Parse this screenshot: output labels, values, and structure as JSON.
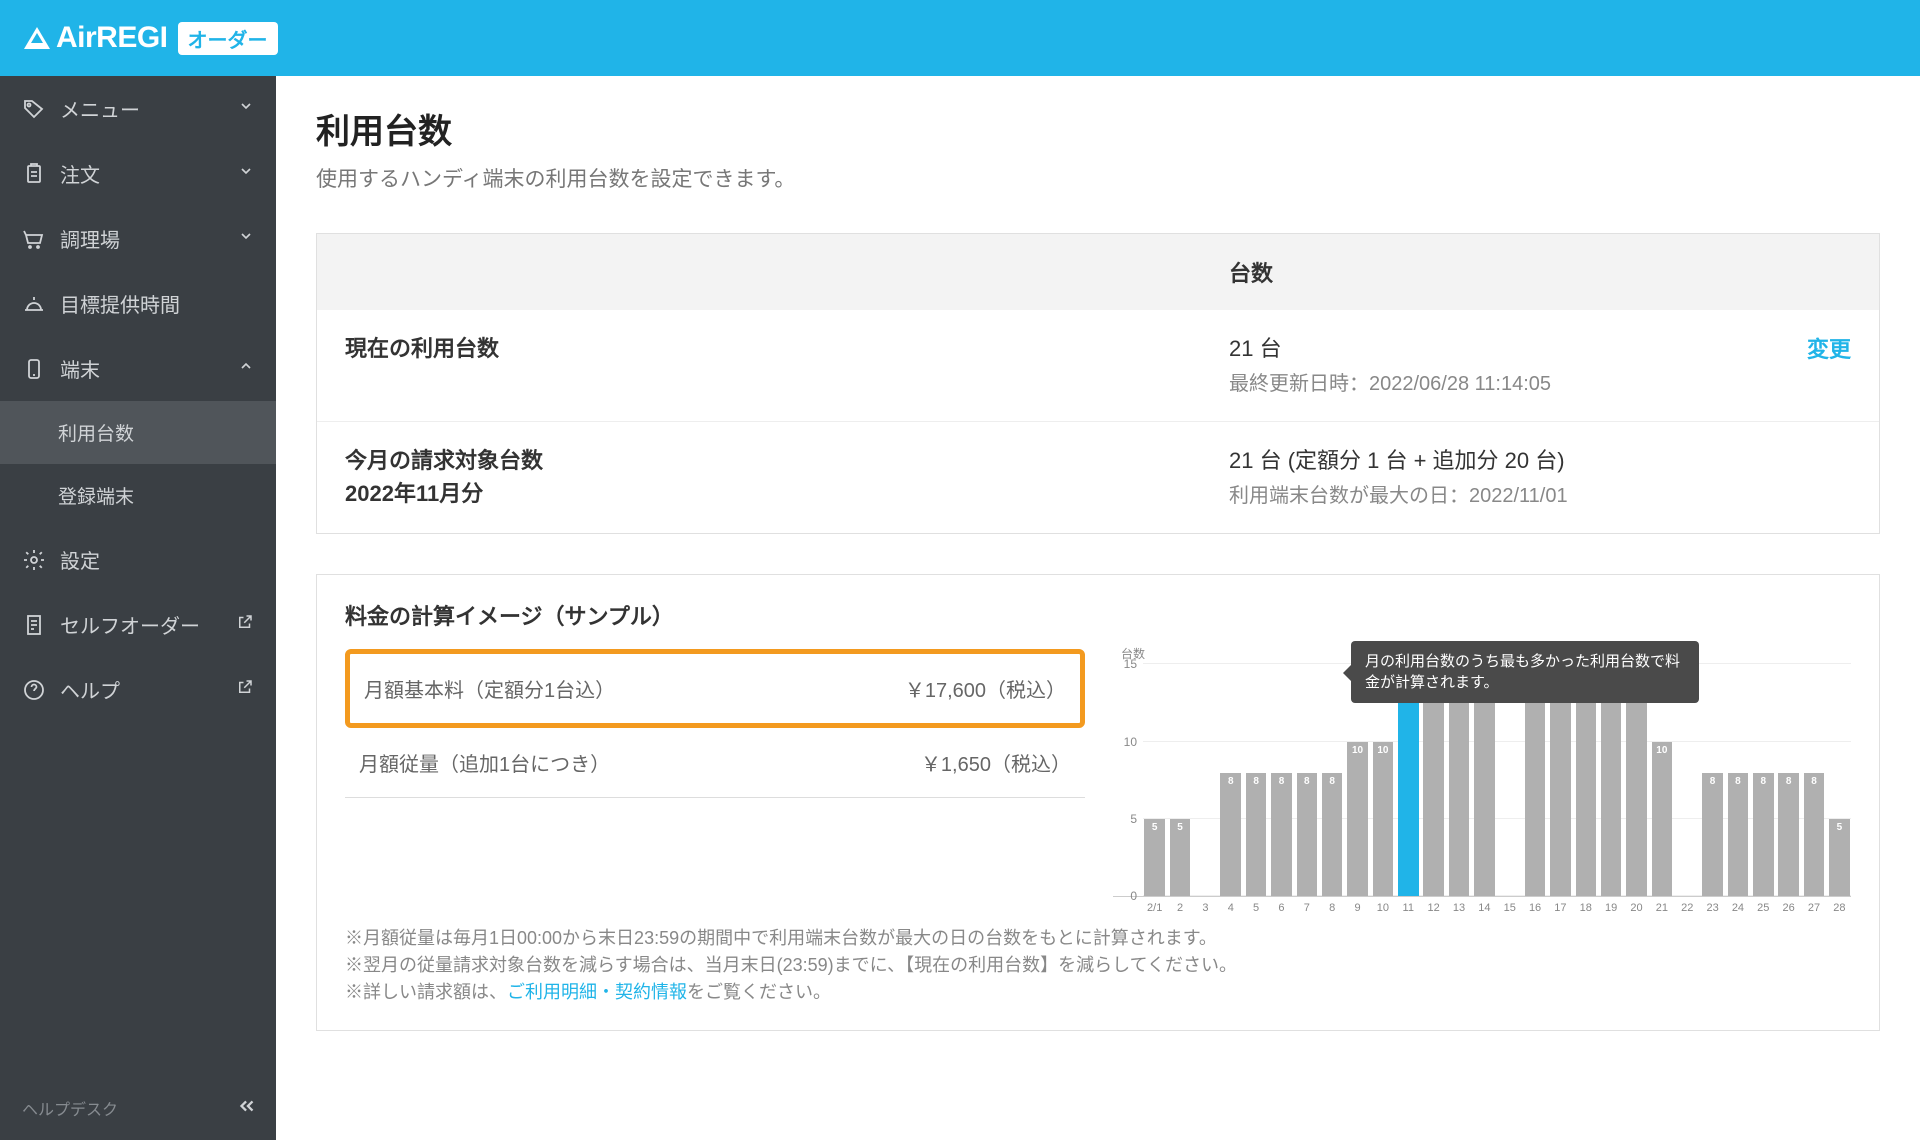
{
  "header": {
    "brand": "AirREGI",
    "badge": "オーダー"
  },
  "sidebar": {
    "items": [
      {
        "id": "menu",
        "label": "メニュー",
        "icon": "tag",
        "expandable": true
      },
      {
        "id": "order",
        "label": "注文",
        "icon": "clipboard",
        "expandable": true
      },
      {
        "id": "kitchen",
        "label": "調理場",
        "icon": "cart",
        "expandable": true
      },
      {
        "id": "target",
        "label": "目標提供時間",
        "icon": "dish"
      },
      {
        "id": "terminal",
        "label": "端末",
        "icon": "phone",
        "expandable": true,
        "expanded": true,
        "children": [
          {
            "id": "usage",
            "label": "利用台数",
            "active": true
          },
          {
            "id": "registered",
            "label": "登録端末"
          }
        ]
      },
      {
        "id": "settings",
        "label": "設定",
        "icon": "gear"
      },
      {
        "id": "selforder",
        "label": "セルフオーダー",
        "icon": "receipt",
        "external": true
      },
      {
        "id": "help",
        "label": "ヘルプ",
        "icon": "help",
        "external": true
      }
    ],
    "helpdesk": "ヘルプデスク"
  },
  "page": {
    "title": "利用台数",
    "subtitle": "使用するハンディ端末の利用台数を設定できます。"
  },
  "table": {
    "header": "台数",
    "rows": [
      {
        "label": "現在の利用台数",
        "value": "21 台",
        "sub": "最終更新日時：2022/06/28 11:14:05",
        "action": "変更"
      },
      {
        "label": "今月の請求対象台数\n2022年11月分",
        "value": "21 台 (定額分 1 台 + 追加分 20 台)",
        "sub": "利用端末台数が最大の日：2022/11/01"
      }
    ]
  },
  "calc": {
    "title": "料金の計算イメージ（サンプル）",
    "rows": [
      {
        "label": "月額基本料（定額分1台込）",
        "price": "￥17,600（税込）",
        "highlight": true
      },
      {
        "label": "月額従量（追加1台につき）",
        "price": "￥1,650（税込）"
      }
    ],
    "tooltip": "月の利用台数のうち最も多かった利用台数で料金が計算されます。",
    "notes": [
      "※月額従量は毎月1日00:00から末日23:59の期間中で利用端末台数が最大の日の台数をもとに計算されます。",
      "※翌月の従量請求対象台数を減らす場合は、当月末日(23:59)までに、【現在の利用台数】を減らしてください。",
      "※詳しい請求額は、"
    ],
    "notes_link": "ご利用明細・契約情報",
    "notes_after": "をご覧ください。"
  },
  "chart_data": {
    "type": "bar",
    "ylabel": "台数",
    "ylim": [
      0,
      16
    ],
    "yticks": [
      0,
      5,
      10,
      15
    ],
    "highlight_index": 10,
    "categories": [
      "2/1",
      "2",
      "3",
      "4",
      "5",
      "6",
      "7",
      "8",
      "9",
      "10",
      "11",
      "12",
      "13",
      "14",
      "15",
      "16",
      "17",
      "18",
      "19",
      "20",
      "21",
      "22",
      "23",
      "24",
      "25",
      "26",
      "27",
      "28"
    ],
    "values": [
      5,
      5,
      null,
      8,
      8,
      8,
      8,
      8,
      10,
      10,
      14,
      14,
      14,
      14,
      null,
      14,
      14,
      14,
      14,
      14,
      10,
      null,
      8,
      8,
      8,
      8,
      8,
      5
    ]
  }
}
